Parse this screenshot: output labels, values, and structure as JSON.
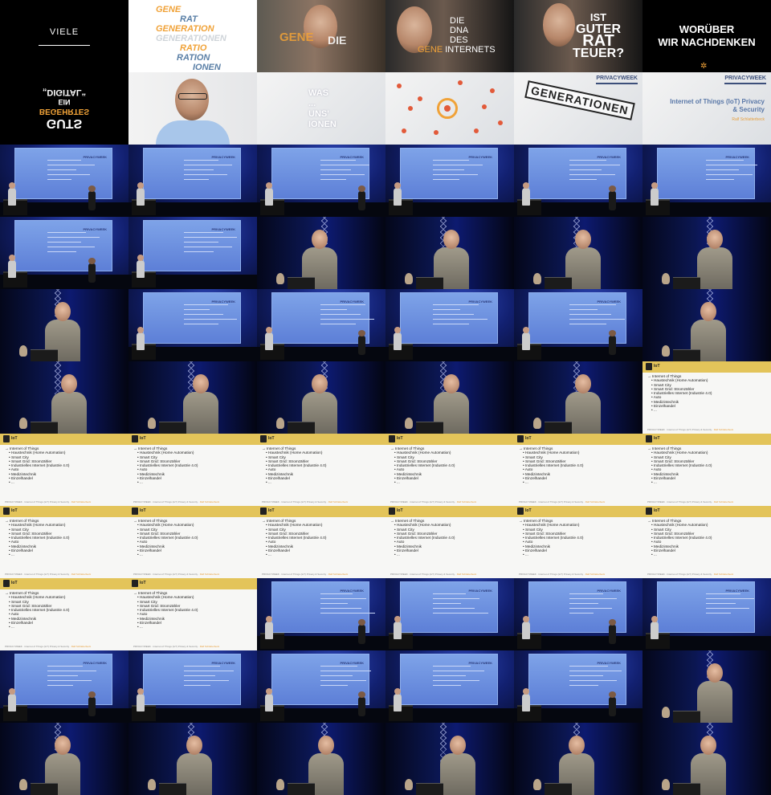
{
  "intro": {
    "viele": "VIELE",
    "words": [
      "GENE",
      "RAT",
      "GENERATION",
      "GENERATIONEN",
      "RATIO",
      "RATION",
      "IONEN"
    ],
    "gene_die_a": "GENE",
    "gene_die_b": "DIE",
    "dna": [
      "DIE",
      "DNA",
      "DES"
    ],
    "dna_gene": "GENE",
    "dna_internets": "INTERNETS",
    "rat": [
      "IST",
      "GUTER",
      "RAT",
      "TEUER?"
    ],
    "woruber": [
      "WORÜBER",
      "WIR NACHDENKEN"
    ],
    "mirror": [
      "GUTS",
      "BEGEHRTES",
      "EIN",
      "„DIGITAL“"
    ],
    "was": [
      "WAS",
      "...",
      "UNS'",
      "IONEN"
    ],
    "stamp": "GENERATIONEN",
    "pw_logo": "PRIVACYWEEK",
    "iot_title": "Internet of Things (IoT) Privacy & Security",
    "iot_author": "Ralf Schlatterbeck"
  },
  "slide": {
    "title": "IoT",
    "items": [
      "Internet of Things",
      "Haustechnik (Home Automation)",
      "Smart City",
      "Smart Grid: Stromzähler",
      "Industrielles Internet (Industrie 4.0)",
      "Auto",
      "Medizintechnik",
      "Einzelhandel",
      "..."
    ],
    "footer": "PRIVACYWEEK · Internet of Things (IoT) Privacy & Security",
    "footer_hl": "Ralf Schlatterbeck"
  },
  "screen_title": "PRIVACYWEEK",
  "layout": [
    [
      "viele",
      "words",
      "gene",
      "dna",
      "rat",
      "woruber"
    ],
    [
      "mirror",
      "portrait",
      "was",
      "net",
      "stamp",
      "iot"
    ],
    [
      "stage",
      "stage",
      "stage",
      "stage",
      "stage",
      "stage"
    ],
    [
      "stage",
      "stage",
      "close",
      "close",
      "close",
      "close"
    ],
    [
      "close",
      "stage",
      "stage",
      "stage",
      "stage",
      "close"
    ],
    [
      "close",
      "close",
      "close",
      "close",
      "close",
      "slide"
    ],
    [
      "slide",
      "slide",
      "slide",
      "slide",
      "slide",
      "slide"
    ],
    [
      "slide",
      "slide",
      "slide",
      "slide",
      "slide",
      "slide"
    ],
    [
      "slide",
      "slide",
      "stage",
      "stage",
      "stage",
      "stage"
    ],
    [
      "stage",
      "stage",
      "stage",
      "stage",
      "stage",
      "close"
    ],
    [
      "close",
      "close",
      "close",
      "close",
      "close",
      "close"
    ]
  ]
}
